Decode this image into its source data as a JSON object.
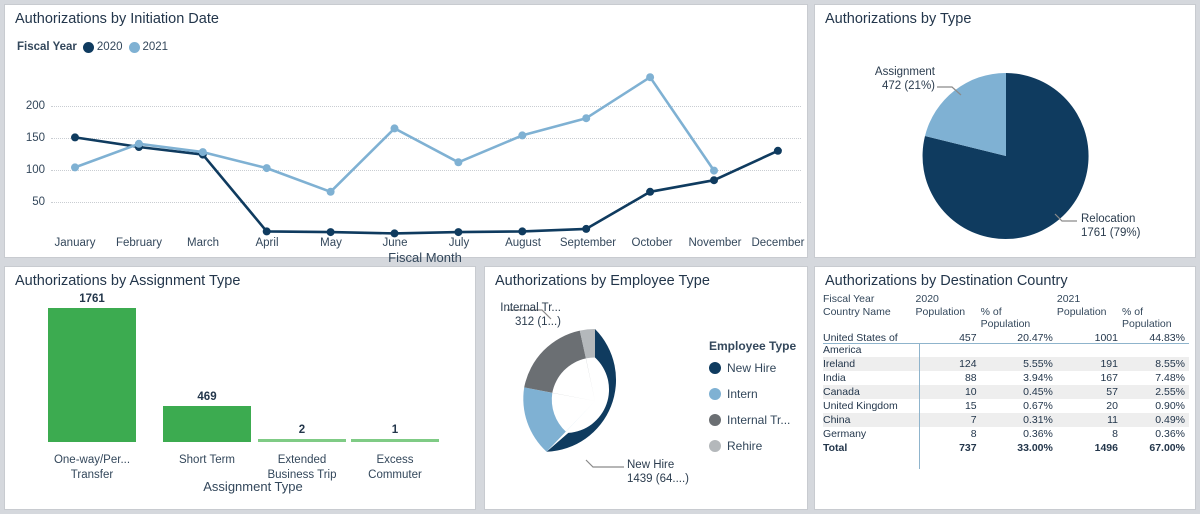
{
  "panels": {
    "line": {
      "title": "Authorizations by Initiation Date"
    },
    "pie": {
      "title": "Authorizations by Type"
    },
    "bar": {
      "title": "Authorizations by Assignment Type"
    },
    "donut": {
      "title": "Authorizations by Employee Type"
    },
    "table": {
      "title": "Authorizations by Destination Country"
    }
  },
  "colors": {
    "dark_blue": "#0f3b5f",
    "light_blue": "#7fb1d3",
    "green": "#3cab50",
    "gray_dark": "#6b6f73",
    "gray_light": "#b4b8bb",
    "page_bg": "#d5d8dd",
    "panel_bg": "#ffffff",
    "text": "#33475b"
  },
  "line_legend": {
    "label": "Fiscal Year",
    "items": [
      {
        "name": "2020",
        "color": "#0f3b5f"
      },
      {
        "name": "2021",
        "color": "#7fb1d3"
      }
    ]
  },
  "chart_data": [
    {
      "id": "authorizations-by-initiation-date",
      "type": "line",
      "title": "Authorizations by Initiation Date",
      "xlabel": "Fiscal Month",
      "ylabel": "",
      "ylim": [
        0,
        250
      ],
      "yticks": [
        50,
        100,
        150,
        200
      ],
      "grid": true,
      "legend_title": "Fiscal Year",
      "legend_position": "top-left",
      "categories": [
        "January",
        "February",
        "March",
        "April",
        "May",
        "June",
        "July",
        "August",
        "September",
        "October",
        "November",
        "December"
      ],
      "series": [
        {
          "name": "2020",
          "color": "#0f3b5f",
          "values": [
            151,
            136,
            124,
            4,
            3,
            1,
            3,
            4,
            8,
            66,
            84,
            130
          ]
        },
        {
          "name": "2021",
          "color": "#7fb1d3",
          "values": [
            104,
            141,
            128,
            103,
            66,
            165,
            112,
            154,
            181,
            245,
            99,
            null
          ]
        }
      ]
    },
    {
      "id": "authorizations-by-type",
      "type": "pie",
      "title": "Authorizations by Type",
      "slices": [
        {
          "label": "Relocation",
          "value": 1761,
          "percent": "79%",
          "display": "Relocation\n1761 (79%)",
          "color": "#0f3b5f"
        },
        {
          "label": "Assignment",
          "value": 472,
          "percent": "21%",
          "display": "Assignment\n472 (21%)",
          "color": "#7fb1d3"
        }
      ],
      "labels": [
        {
          "name": "Assignment",
          "value_text": "472 (21%)"
        },
        {
          "name": "Relocation",
          "value_text": "1761 (79%)"
        }
      ]
    },
    {
      "id": "authorizations-by-assignment-type",
      "type": "bar",
      "title": "Authorizations by Assignment Type",
      "xlabel": "Assignment Type",
      "ylabel": "",
      "ylim": [
        0,
        1900
      ],
      "grid": false,
      "color": "#3cab50",
      "categories": [
        "One-way/Per... Transfer",
        "Short Term",
        "Extended Business Trip",
        "Excess Commuter"
      ],
      "category_lines": [
        [
          "One-way/Per...",
          "Transfer"
        ],
        [
          "Short Term",
          ""
        ],
        [
          "Extended",
          "Business Trip"
        ],
        [
          "Excess",
          "Commuter"
        ]
      ],
      "values": [
        1761,
        469,
        2,
        1
      ],
      "value_labels": [
        "1761",
        "469",
        "2",
        "1"
      ]
    },
    {
      "id": "authorizations-by-employee-type",
      "type": "pie",
      "subtype": "donut",
      "title": "Authorizations by Employee Type",
      "legend_title": "Employee Type",
      "legend_position": "right",
      "slices": [
        {
          "label": "New Hire",
          "value": 1439,
          "percent": "64...",
          "color": "#0f3b5f"
        },
        {
          "label": "Intern",
          "value": 465,
          "percent": "",
          "color": "#7fb1d3"
        },
        {
          "label": "Internal Tr...",
          "value": 312,
          "percent": "1...",
          "color": "#6b6f73"
        },
        {
          "label": "Rehire",
          "value": 17,
          "percent": "",
          "color": "#b4b8bb"
        }
      ],
      "callouts": [
        {
          "name": "Internal Tr...",
          "value_text": "312 (1...)"
        },
        {
          "name": "New Hire",
          "value_text": "1439 (64....)"
        }
      ],
      "legend_items": [
        {
          "label": "New Hire",
          "color": "#0f3b5f"
        },
        {
          "label": "Intern",
          "color": "#7fb1d3"
        },
        {
          "label": "Internal Tr...",
          "color": "#6b6f73"
        },
        {
          "label": "Rehire",
          "color": "#b4b8bb"
        }
      ]
    },
    {
      "id": "authorizations-by-destination-country",
      "type": "table",
      "title": "Authorizations by Destination Country",
      "header_row1": [
        "Fiscal Year",
        "2020",
        "",
        "2021",
        ""
      ],
      "header_row2": [
        "Country Name",
        "Population",
        "% of Population",
        "Population",
        "% of Population"
      ],
      "rows": [
        {
          "country": "United States of America",
          "p2020": "457",
          "pct2020": "20.47%",
          "p2021": "1001",
          "pct2021": "44.83%"
        },
        {
          "country": "Ireland",
          "p2020": "124",
          "pct2020": "5.55%",
          "p2021": "191",
          "pct2021": "8.55%"
        },
        {
          "country": "India",
          "p2020": "88",
          "pct2020": "3.94%",
          "p2021": "167",
          "pct2021": "7.48%"
        },
        {
          "country": "Canada",
          "p2020": "10",
          "pct2020": "0.45%",
          "p2021": "57",
          "pct2021": "2.55%"
        },
        {
          "country": "United Kingdom",
          "p2020": "15",
          "pct2020": "0.67%",
          "p2021": "20",
          "pct2021": "0.90%"
        },
        {
          "country": "China",
          "p2020": "7",
          "pct2020": "0.31%",
          "p2021": "11",
          "pct2021": "0.49%"
        },
        {
          "country": "Germany",
          "p2020": "8",
          "pct2020": "0.36%",
          "p2021": "8",
          "pct2021": "0.36%"
        },
        {
          "country": "Total",
          "p2020": "737",
          "pct2020": "33.00%",
          "p2021": "1496",
          "pct2021": "67.00%"
        }
      ]
    }
  ]
}
